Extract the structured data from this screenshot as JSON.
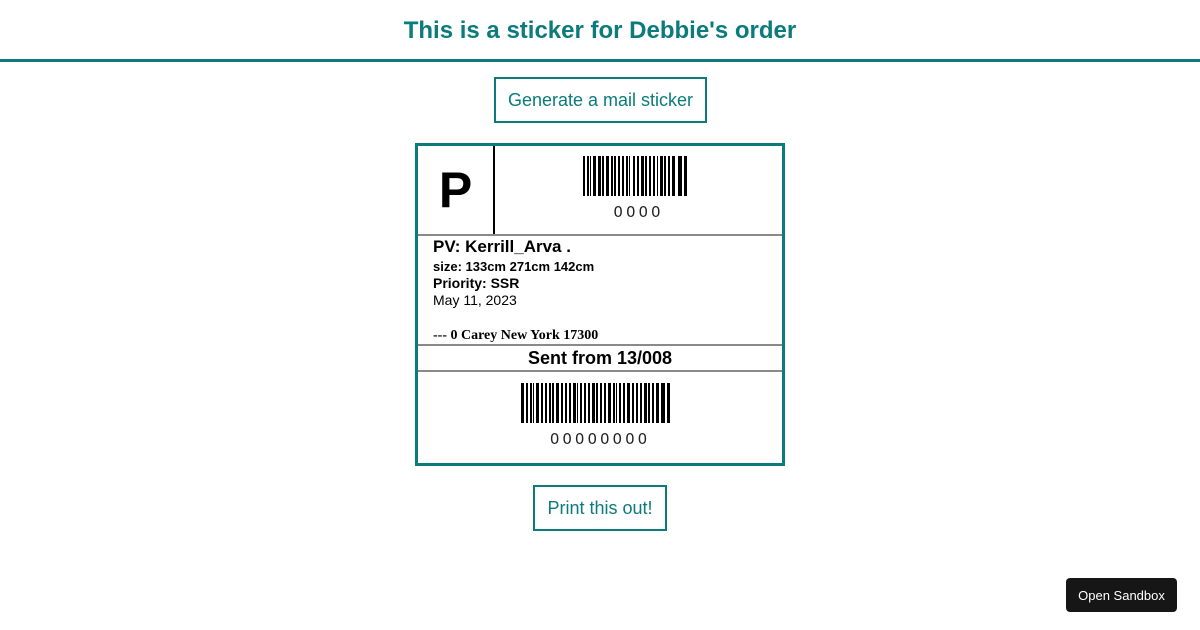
{
  "header": {
    "title": "This is a sticker for Debbie's order"
  },
  "buttons": {
    "generate_label": "Generate a mail sticker",
    "print_label": "Print this out!",
    "sandbox_label": "Open Sandbox"
  },
  "sticker": {
    "priority_letter": "P",
    "top_barcode_number": "0000",
    "recipient": "PV: Kerrill_Arva .",
    "size": "size: 133cm 271cm 142cm",
    "priority": "Priority: SSR",
    "date": "May 11, 2023",
    "address": "--- 0 Carey New York 17300",
    "sent_from": "Sent from 13/008",
    "bottom_barcode_number": "00000000"
  },
  "colors": {
    "accent": "#0b7b7b",
    "sandbox_bg": "#161616"
  }
}
